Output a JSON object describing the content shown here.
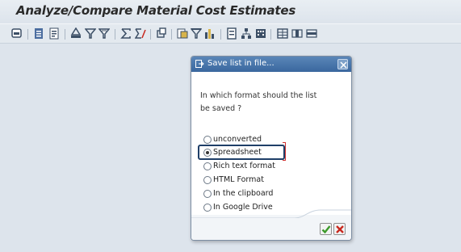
{
  "window": {
    "title": "Analyze/Compare Material Cost Estimates"
  },
  "toolbar": {
    "icons": [
      "overview-icon",
      "list-icon",
      "detail-icon",
      "print-icon",
      "filter-icon",
      "filter-settings-icon",
      "sum-icon",
      "subtotal-icon",
      "refresh-icon",
      "export-icon",
      "sort-icon",
      "chart-icon",
      "layout-icon",
      "hierarchy-icon",
      "grid-icon",
      "table-icon",
      "column-icon",
      "row-icon"
    ]
  },
  "dialog": {
    "title": "Save list in file...",
    "question": "In which format should the list be saved ?",
    "question_line1": "In which format should the list",
    "question_line2": "be saved ?",
    "options": [
      {
        "label": "unconverted",
        "selected": false
      },
      {
        "label": "Spreadsheet",
        "selected": true
      },
      {
        "label": "Rich text format",
        "selected": false
      },
      {
        "label": "HTML Format",
        "selected": false
      },
      {
        "label": "In the clipboard",
        "selected": false
      },
      {
        "label": "In Google Drive",
        "selected": false
      }
    ],
    "colors": {
      "header": "#3a679e",
      "highlight": "#1f3f68",
      "ok": "#3c9a2a",
      "cancel": "#c8281e"
    }
  }
}
